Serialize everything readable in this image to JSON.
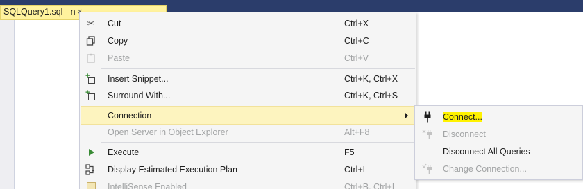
{
  "document_tab": {
    "title": "SQLQuery1.sql - n",
    "close_glyph": "×"
  },
  "context_menu": {
    "items": [
      {
        "label": "Cut",
        "shortcut": "Ctrl+X",
        "icon": "cut-icon",
        "disabled": false
      },
      {
        "label": "Copy",
        "shortcut": "Ctrl+C",
        "icon": "copy-icon",
        "disabled": false
      },
      {
        "label": "Paste",
        "shortcut": "Ctrl+V",
        "icon": "paste-icon",
        "disabled": true
      },
      {
        "label": "Insert Snippet...",
        "shortcut": "Ctrl+K, Ctrl+X",
        "icon": "insert-snippet-icon",
        "disabled": false
      },
      {
        "label": "Surround With...",
        "shortcut": "Ctrl+K, Ctrl+S",
        "icon": "surround-with-icon",
        "disabled": false
      },
      {
        "label": "Connection",
        "shortcut": "",
        "icon": "",
        "disabled": false,
        "has_submenu": true,
        "highlighted": true
      },
      {
        "label": "Open Server in Object Explorer",
        "shortcut": "Alt+F8",
        "icon": "",
        "disabled": true
      },
      {
        "label": "Execute",
        "shortcut": "F5",
        "icon": "execute-icon",
        "disabled": false
      },
      {
        "label": "Display Estimated Execution Plan",
        "shortcut": "Ctrl+L",
        "icon": "execution-plan-icon",
        "disabled": false
      },
      {
        "label": "IntelliSense Enabled",
        "shortcut": "Ctrl+B, Ctrl+I",
        "icon": "intellisense-icon",
        "disabled": true
      }
    ]
  },
  "connection_submenu": {
    "items": [
      {
        "label": "Connect...",
        "icon": "plug-icon",
        "disabled": false,
        "highlighted": true
      },
      {
        "label": "Disconnect",
        "icon": "unplug-icon",
        "disabled": true
      },
      {
        "label": "Disconnect All Queries",
        "icon": "",
        "disabled": false
      },
      {
        "label": "Change Connection...",
        "icon": "change-connection-icon",
        "disabled": true
      }
    ]
  },
  "colors": {
    "menu_background": "#f5f5f5",
    "highlight_row": "#fdf4bf",
    "tab_yellow": "#fff29d",
    "title_bar": "#2b3d6b",
    "text_highlight": "#fff200"
  }
}
